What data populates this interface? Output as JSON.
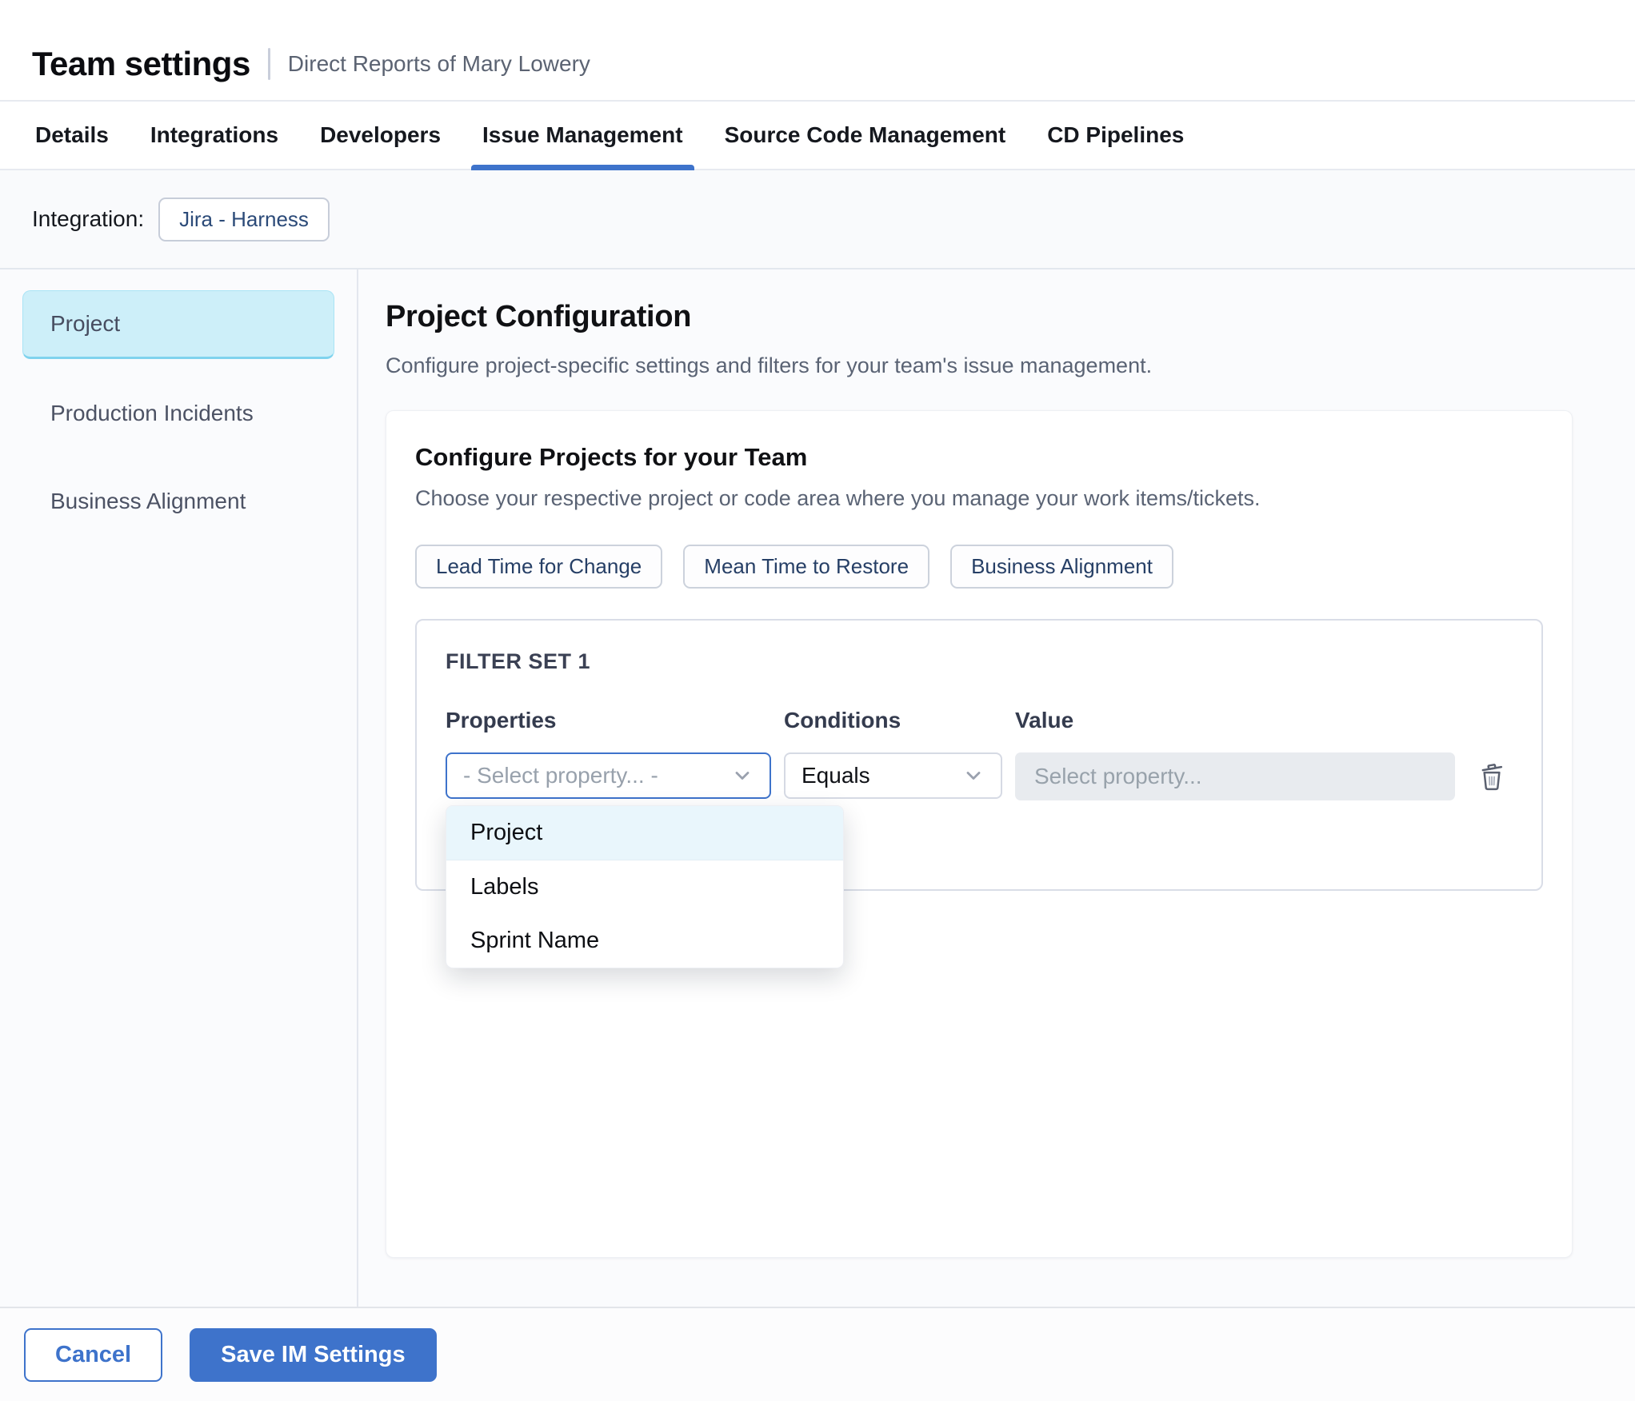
{
  "header": {
    "title": "Team settings",
    "subtitle": "Direct Reports of Mary Lowery"
  },
  "tabs": [
    {
      "label": "Details",
      "active": false
    },
    {
      "label": "Integrations",
      "active": false
    },
    {
      "label": "Developers",
      "active": false
    },
    {
      "label": "Issue Management",
      "active": true
    },
    {
      "label": "Source Code Management",
      "active": false
    },
    {
      "label": "CD Pipelines",
      "active": false
    }
  ],
  "integration": {
    "label": "Integration:",
    "value": "Jira - Harness"
  },
  "sidebar": {
    "items": [
      {
        "label": "Project",
        "selected": true
      },
      {
        "label": "Production Incidents",
        "selected": false
      },
      {
        "label": "Business Alignment",
        "selected": false
      }
    ]
  },
  "main": {
    "title": "Project Configuration",
    "subtitle": "Configure project-specific settings and filters for your team's issue management.",
    "card": {
      "title": "Configure Projects for your Team",
      "subtitle": "Choose your respective project or code area where you manage your work items/tickets.",
      "chips": [
        {
          "label": "Lead Time for Change"
        },
        {
          "label": "Mean Time to Restore"
        },
        {
          "label": "Business Alignment"
        }
      ],
      "filter_set": {
        "title": "FILTER SET 1",
        "columns": {
          "properties": "Properties",
          "conditions": "Conditions",
          "value": "Value"
        },
        "properties_placeholder": "- Select property... -",
        "conditions_value": "Equals",
        "value_placeholder": "Select property...",
        "dropdown_options": [
          {
            "label": "Project",
            "highlighted": true
          },
          {
            "label": "Labels",
            "highlighted": false
          },
          {
            "label": "Sprint Name",
            "highlighted": false
          }
        ]
      }
    }
  },
  "footer": {
    "cancel_label": "Cancel",
    "save_label": "Save IM Settings"
  },
  "icons": {
    "properties_chevron": "chevron-down-icon",
    "conditions_chevron": "chevron-down-icon",
    "delete": "trash-icon"
  },
  "colors": {
    "primary_blue": "#3e73cb",
    "selected_sidebar_bg": "#cdeff9",
    "selected_sidebar_border": "#7fd3ee",
    "dropdown_highlight_bg": "#e9f6fc",
    "disabled_input_bg": "#e8ebef",
    "chip_text": "#263f66",
    "muted_text": "#5a6374"
  }
}
